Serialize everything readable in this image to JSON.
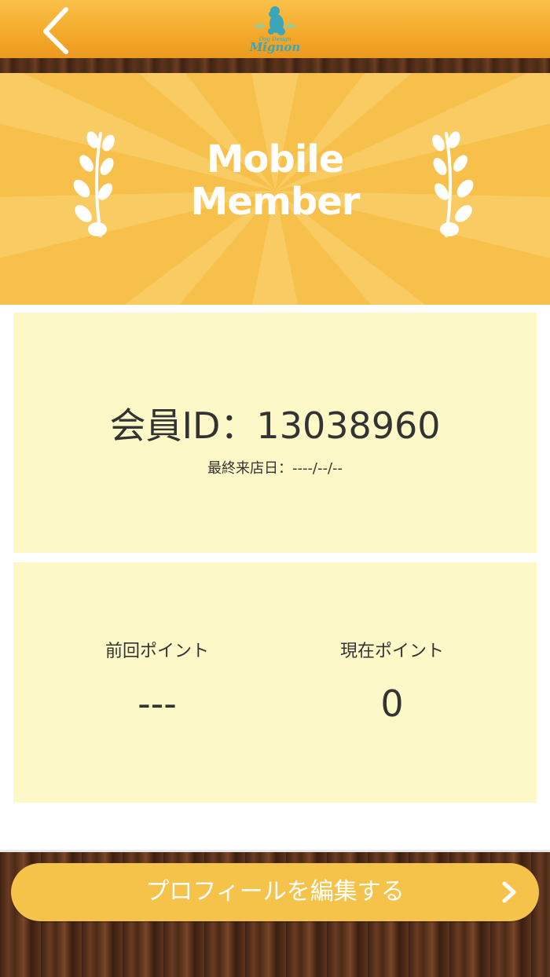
{
  "header": {
    "back_icon": "chevron-left-icon",
    "logo": {
      "small_text": "Dog Design",
      "name": "Mignon",
      "icon": "poodle-logo-icon"
    }
  },
  "banner": {
    "title_line1": "Mobile",
    "title_line2": "Member",
    "left_icon": "laurel-branch-icon",
    "right_icon": "laurel-branch-icon"
  },
  "member": {
    "id_text": "会員ID：13038960",
    "last_visit_text": "最終来店日：----/--/--"
  },
  "points": {
    "previous": {
      "label": "前回ポイント",
      "value": "---"
    },
    "current": {
      "label": "現在ポイント",
      "value": "0"
    }
  },
  "footer": {
    "edit_profile_label": "プロフィールを編集する",
    "chevron_icon": "chevron-right-icon"
  },
  "colors": {
    "header": "#f4a92a",
    "banner": "#f6c04a",
    "card": "#fdf8c8",
    "button": "#f5c24a",
    "wood": "#4a2a17",
    "logo": "#3aa6b7",
    "text": "#333333"
  }
}
